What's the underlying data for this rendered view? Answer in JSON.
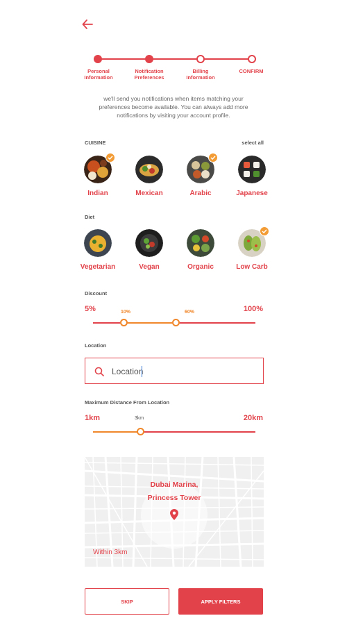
{
  "header": {
    "back_icon": "arrow-left-icon"
  },
  "stepper": {
    "steps": [
      {
        "label": "Personal\nInformation",
        "state": "done"
      },
      {
        "label": "Notification\nPreferences",
        "state": "current"
      },
      {
        "label": "Billing\nInformation",
        "state": "pending"
      },
      {
        "label": "CONFIRM",
        "state": "pending"
      }
    ]
  },
  "intro": "we'll send you notifications when items matching your preferences become available. You can always add more notifications by visiting your account profile.",
  "cuisine": {
    "label": "CUISINE",
    "select_all": "select all",
    "items": [
      {
        "name": "Indian",
        "selected": true
      },
      {
        "name": "Mexican",
        "selected": false
      },
      {
        "name": "Arabic",
        "selected": true
      },
      {
        "name": "Japanese",
        "selected": false
      }
    ]
  },
  "diet": {
    "label": "Diet",
    "items": [
      {
        "name": "Vegetarian",
        "selected": false
      },
      {
        "name": "Vegan",
        "selected": false
      },
      {
        "name": "Organic",
        "selected": false
      },
      {
        "name": "Low Carb",
        "selected": true
      }
    ]
  },
  "discount": {
    "label": "Discount",
    "min_label": "5%",
    "max_label": "100%",
    "low_label": "10%",
    "high_label": "60%"
  },
  "location": {
    "label": "Location",
    "value": "Location",
    "placeholder": "Location"
  },
  "distance": {
    "label": "Maximum Distance From Location",
    "min_label": "1km",
    "max_label": "20km",
    "current_label": "3km"
  },
  "map": {
    "place": "Dubai Marina,",
    "place2": "Princess Tower",
    "radius_text": "Within 3km"
  },
  "actions": {
    "skip": "SKIP",
    "apply": "APPLY FILTERS"
  },
  "colors": {
    "accent": "#e2434b",
    "orange": "#f0872a",
    "check": "#f39c35"
  }
}
